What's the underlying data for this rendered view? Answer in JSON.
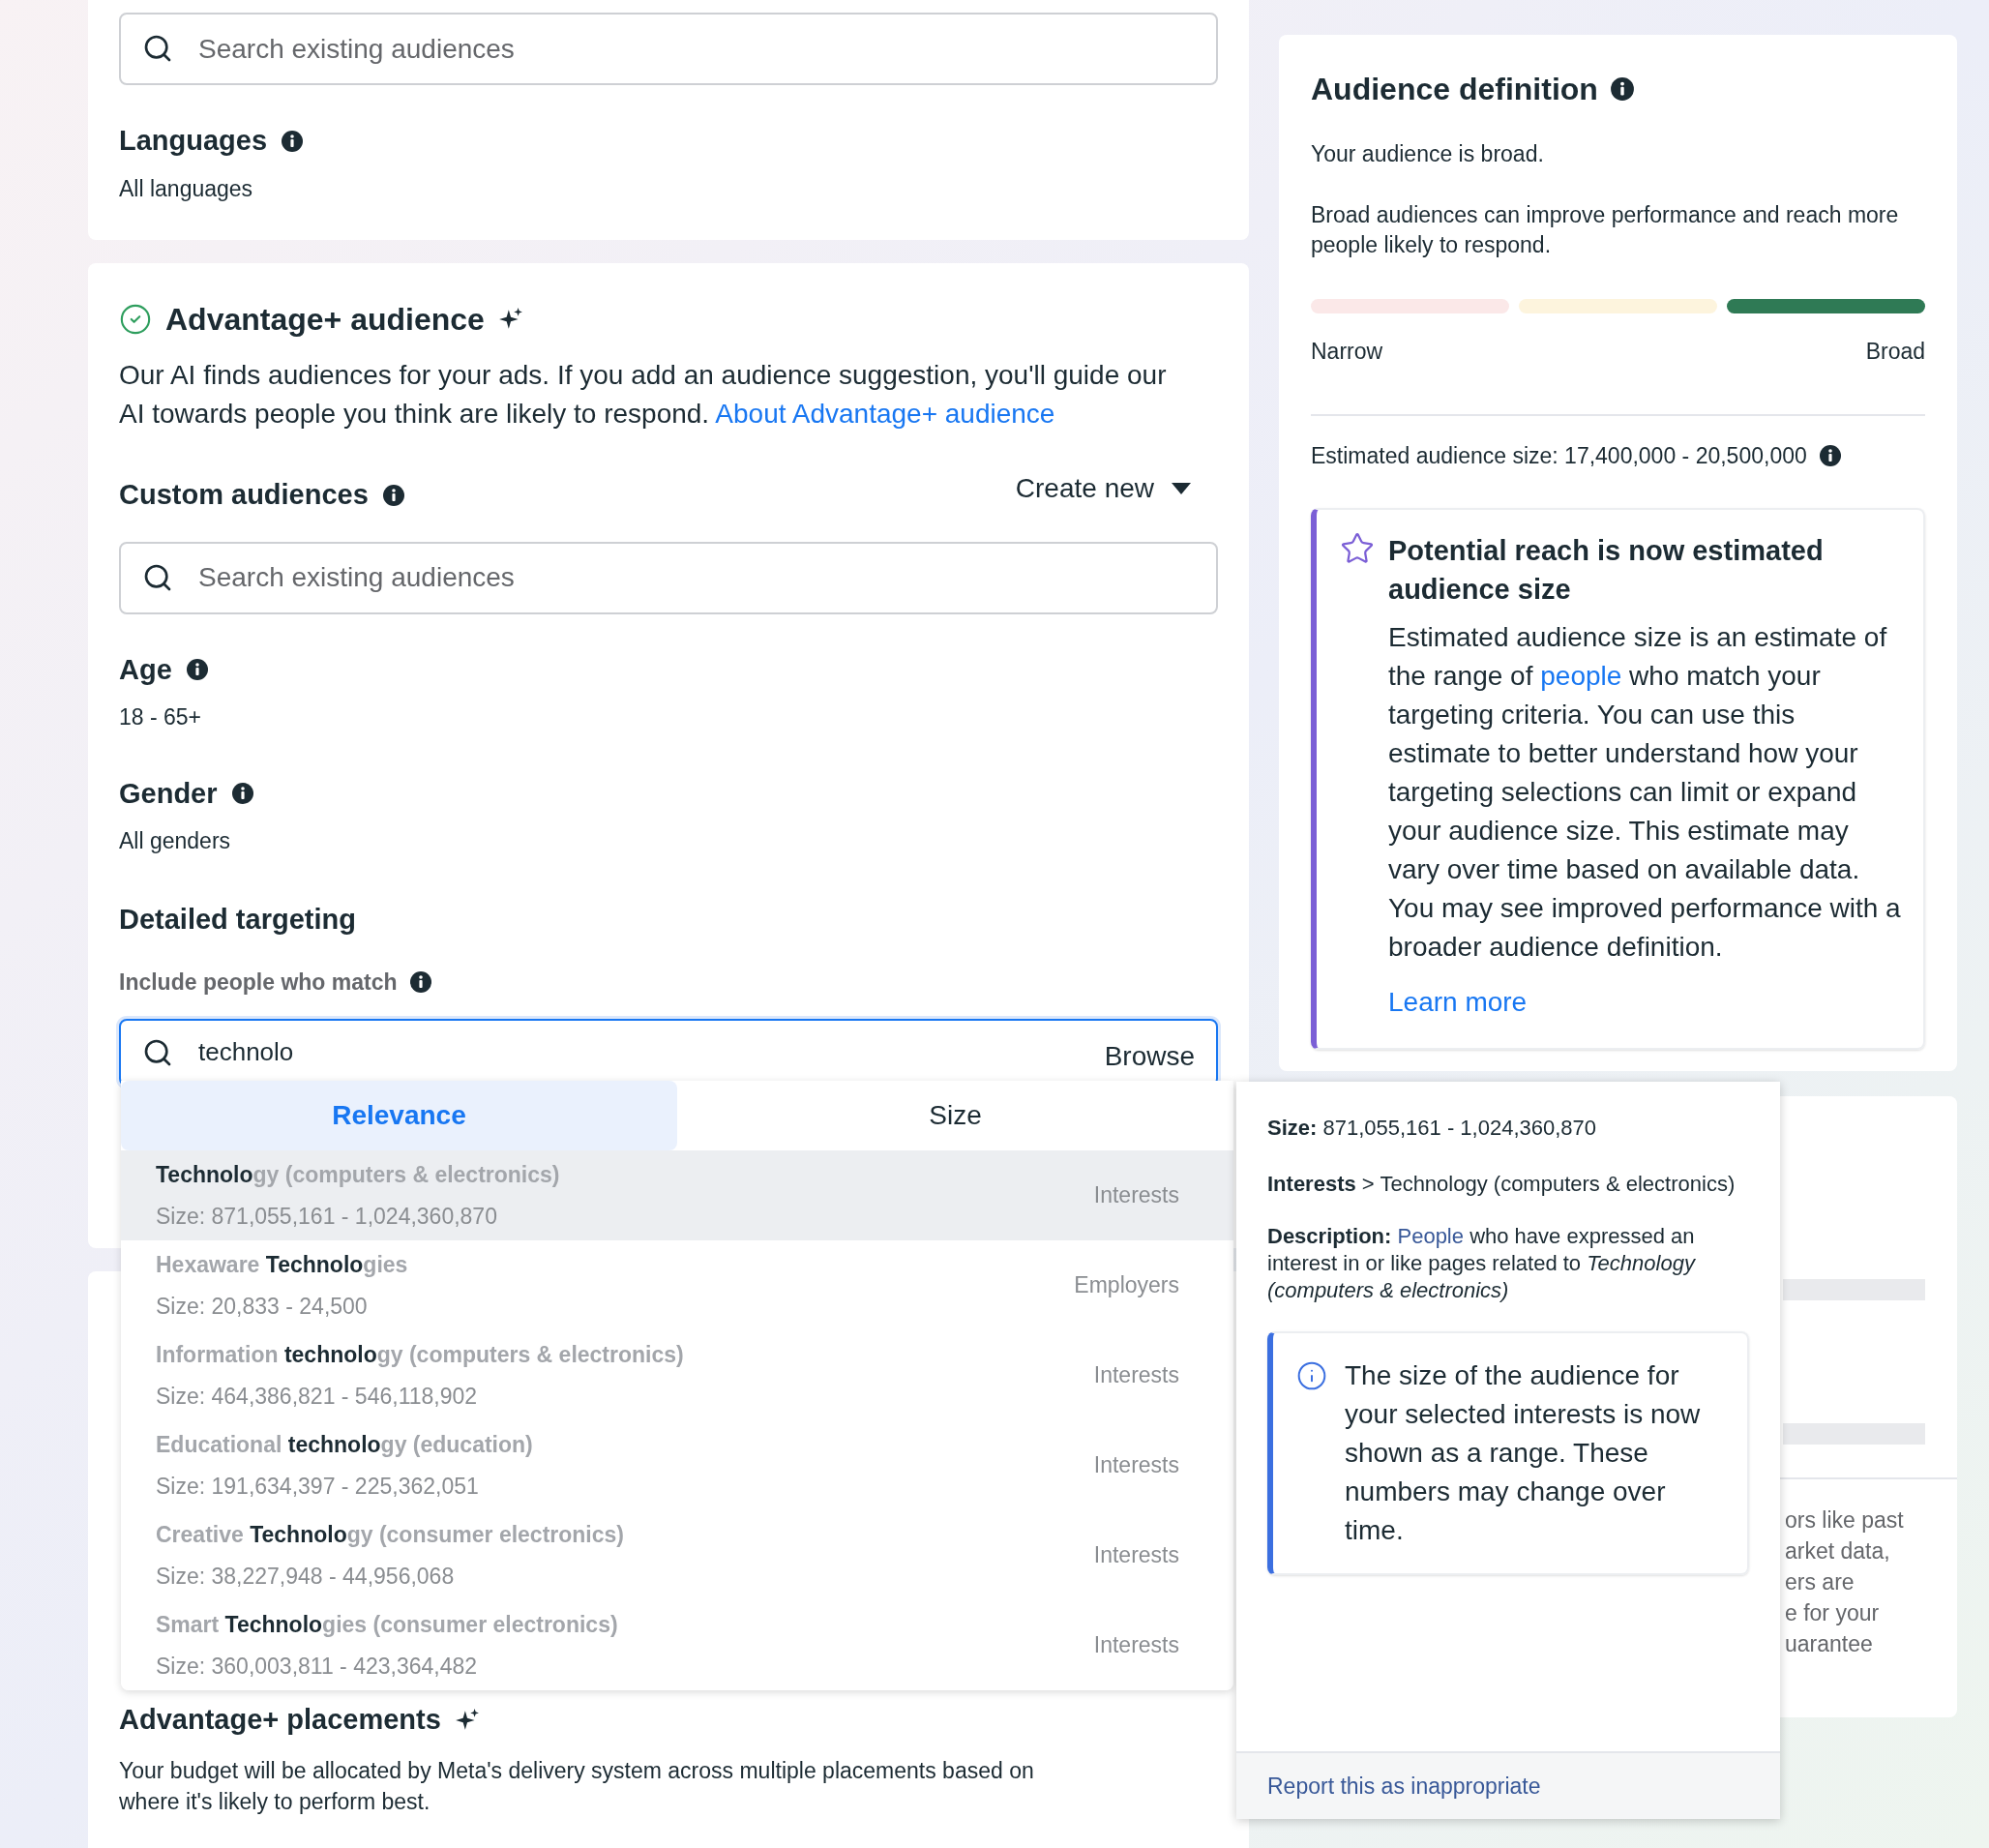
{
  "languages_card": {
    "search": {
      "placeholder": "Search existing audiences"
    },
    "languages": {
      "label": "Languages",
      "value": "All languages"
    }
  },
  "advantage_audience": {
    "title": "Advantage+ audience",
    "description": "Our AI finds audiences for your ads. If you add an audience suggestion, you'll guide our AI towards people you think are likely to respond.",
    "link": "About Advantage+ audience",
    "custom_audiences": {
      "label": "Custom audiences",
      "action": "Create new",
      "search": {
        "placeholder": "Search existing audiences"
      }
    },
    "age": {
      "label": "Age",
      "value": "18 - 65+"
    },
    "gender": {
      "label": "Gender",
      "value": "All genders"
    },
    "detailed_targeting": {
      "title": "Detailed targeting",
      "include_label": "Include people who match",
      "search": {
        "value": "technolo",
        "action": "Browse"
      }
    }
  },
  "suggestions": {
    "tabs": [
      {
        "label": "Relevance",
        "selected": true
      },
      {
        "label": "Size",
        "selected": false
      }
    ],
    "items": [
      {
        "name": "**Technolo**gy (computers & electronics)",
        "size": "Size: 871,055,161 - 1,024,360,870",
        "category": "Interests",
        "selected": true
      },
      {
        "name": "Hexaware **Technolo**gies",
        "size": "Size: 20,833 - 24,500",
        "category": "Employers",
        "selected": false
      },
      {
        "name": "Information **technolo**gy (computers & electronics)",
        "size": "Size: 464,386,821 - 546,118,902",
        "category": "Interests",
        "selected": false
      },
      {
        "name": "Educational **technolo**gy (education)",
        "size": "Size: 191,634,397 - 225,362,051",
        "category": "Interests",
        "selected": false
      },
      {
        "name": "Creative **Technolo**gy (consumer electronics)",
        "size": "Size: 38,227,948 - 44,956,068",
        "category": "Interests",
        "selected": false
      },
      {
        "name": "Smart **Technolo**gies (consumer electronics)",
        "size": "Size: 360,003,811 - 423,364,482",
        "category": "Interests",
        "selected": false
      }
    ]
  },
  "detail_tooltip": {
    "size": "**Size:** 871,055,161 - 1,024,360,870",
    "path": "**Interests** > Technology (computers & electronics)",
    "description_label": "Description:",
    "description_link": "People",
    "description_rest": "who have expressed an interest in or like pages related to *Technology (computers & electronics)*",
    "notice": "The size of the audience for your selected interests is now shown as a range. These numbers may change over time.",
    "report_link": "Report this as inappropriate"
  },
  "placements": {
    "title": "Advantage+ placements",
    "description": "Your budget will be allocated by Meta's delivery system across multiple placements based on where it's likely to perform best."
  },
  "audience_definition": {
    "title": "Audience definition",
    "status": "Your audience is broad.",
    "explanation": "Broad audiences can improve performance and reach more people likely to respond.",
    "meter": [
      {
        "selected": false
      },
      {
        "selected": false
      },
      {
        "selected": true
      }
    ],
    "meter_min": "Narrow",
    "meter_max": "Broad",
    "estimate": "Estimated audience size: 17,400,000 - 20,500,000",
    "notice": {
      "title": "Potential reach is now estimated audience size",
      "before_link": "Estimated audience size is an estimate of the range of",
      "link": "people",
      "after_link": "who match your targeting criteria. You can use this estimate to better understand how your targeting selections can limit or expand your audience size. This estimate may vary over time based on available data. You may see improved performance with a broader audience definition.",
      "learn_more": "Learn more"
    }
  },
  "estimate_card": {
    "lines": [
      "ors like past",
      "arket data,",
      "ers are",
      "e for your",
      "uarantee"
    ]
  }
}
